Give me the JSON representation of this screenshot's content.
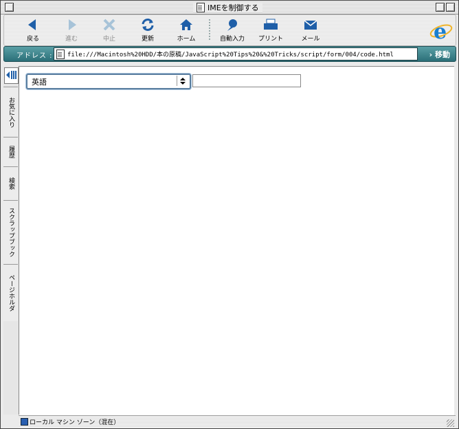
{
  "window": {
    "title": "IMEを制御する"
  },
  "toolbar": {
    "buttons": [
      {
        "label": "戻る",
        "icon": "back-arrow-icon",
        "enabled": true
      },
      {
        "label": "進む",
        "icon": "forward-arrow-icon",
        "enabled": false
      },
      {
        "label": "中止",
        "icon": "stop-x-icon",
        "enabled": false
      },
      {
        "label": "更新",
        "icon": "refresh-icon",
        "enabled": true
      },
      {
        "label": "ホーム",
        "icon": "home-icon",
        "enabled": true
      },
      {
        "label": "自動入力",
        "icon": "autofill-pen-icon",
        "enabled": true
      },
      {
        "label": "プリント",
        "icon": "printer-icon",
        "enabled": true
      },
      {
        "label": "メール",
        "icon": "envelope-icon",
        "enabled": true
      }
    ],
    "logo_icon": "internet-explorer-e-logo"
  },
  "address": {
    "label": "アドレス :",
    "url": "file:///Macintosh%20HDD/本の原稿/JavaScript%20Tips%20&%20Tricks/script/form/004/code.html",
    "go_label": "移動"
  },
  "explorer_tabs": [
    "お気に入り",
    "履歴",
    "検索",
    "スクラップブック",
    "ページホルダ"
  ],
  "page": {
    "select_value": "英語",
    "text_input_value": ""
  },
  "status": {
    "text": "ローカル マシン ゾーン（混在）"
  },
  "colors": {
    "accent_teal": "#2b6f78",
    "icon_blue": "#1f5fa8"
  }
}
